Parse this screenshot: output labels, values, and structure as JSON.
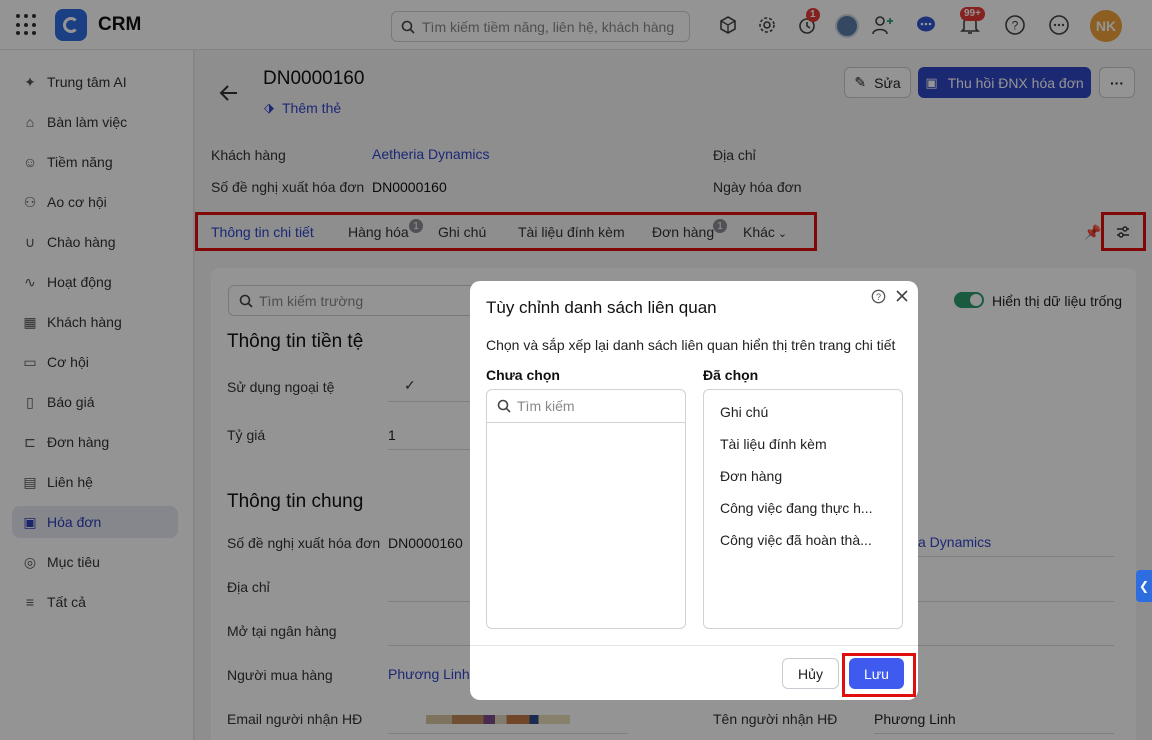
{
  "app": {
    "name": "CRM",
    "search_placeholder": "Tìm kiếm tiềm năng, liên hệ, khách hàng",
    "notif_timer_count": "1",
    "notif_bell_count": "99+",
    "avatar_initials": "NK"
  },
  "sidebar": {
    "items": [
      {
        "label": "Trung tâm AI",
        "icon": "sparkle-icon"
      },
      {
        "label": "Bàn làm việc",
        "icon": "home-icon"
      },
      {
        "label": "Tiềm năng",
        "icon": "lead-icon"
      },
      {
        "label": "Ao cơ hội",
        "icon": "opportunity-pool-icon"
      },
      {
        "label": "Chào hàng",
        "icon": "magnet-icon"
      },
      {
        "label": "Hoạt động",
        "icon": "activity-icon"
      },
      {
        "label": "Khách hàng",
        "icon": "building-icon"
      },
      {
        "label": "Cơ hội",
        "icon": "opportunity-icon"
      },
      {
        "label": "Báo giá",
        "icon": "quote-icon"
      },
      {
        "label": "Đơn hàng",
        "icon": "cart-icon"
      },
      {
        "label": "Liên hệ",
        "icon": "contact-icon"
      },
      {
        "label": "Hóa đơn",
        "icon": "invoice-icon"
      },
      {
        "label": "Mục tiêu",
        "icon": "target-icon"
      },
      {
        "label": "Tất cả",
        "icon": "menu-icon"
      }
    ]
  },
  "record": {
    "code": "DN0000160",
    "add_tag": "Thêm thẻ",
    "edit_label": "Sửa",
    "primary_action": "Thu hồi ĐNX hóa đơn",
    "more_label": "···"
  },
  "summary": {
    "customer_label": "Khách hàng",
    "customer_value": "Aetheria Dynamics",
    "address_label": "Địa chỉ",
    "request_no_label": "Số đề nghị xuất hóa đơn",
    "request_no_value": "DN0000160",
    "invoice_date_label": "Ngày hóa đơn"
  },
  "tabs": [
    {
      "label": "Thông tin chi tiết",
      "badge": ""
    },
    {
      "label": "Hàng hóa",
      "badge": "1"
    },
    {
      "label": "Ghi chú",
      "badge": ""
    },
    {
      "label": "Tài liệu đính kèm",
      "badge": ""
    },
    {
      "label": "Đơn hàng",
      "badge": "1"
    },
    {
      "label": "Khác",
      "badge": ""
    }
  ],
  "detail": {
    "field_search_placeholder": "Tìm kiếm trường",
    "show_empty_label": "Hiển thị dữ liệu trống",
    "section_currency": "Thông tin tiền tệ",
    "use_foreign_currency_label": "Sử dụng ngoại tệ",
    "use_foreign_currency_value": "✓",
    "exchange_rate_label": "Tỷ giá",
    "exchange_rate_value": "1",
    "section_general": "Thông tin chung",
    "request_no_label": "Số đề nghị xuất hóa đơn",
    "request_no_value": "DN0000160",
    "customer_partial": "a Dynamics",
    "address_label": "Địa chỉ",
    "bank_label": "Mở tại ngân hàng",
    "buyer_label": "Người mua hàng",
    "buyer_value": "Phương Linh",
    "email_label": "Email người nhận HĐ",
    "recipient_label": "Tên người nhận HĐ",
    "recipient_value": "Phương Linh"
  },
  "modal": {
    "title": "Tùy chỉnh danh sách liên quan",
    "description": "Chọn và sắp xếp lại danh sách liên quan hiển thị trên trang chi tiết",
    "unselected_title": "Chưa chọn",
    "search_placeholder": "Tìm kiếm",
    "selected_title": "Đã chọn",
    "selected_items": [
      "Ghi chú",
      "Tài liệu đính kèm",
      "Đơn hàng",
      "Công việc đang thực h...",
      "Công việc đã hoàn thà..."
    ],
    "cancel_label": "Hủy",
    "save_label": "Lưu"
  },
  "colors": {
    "primary": "#2f45c5",
    "active_nav_bg": "#e5e8f3",
    "highlight": "#e10e0e",
    "toggle": "#2e9e6e",
    "badge_red": "#e53935"
  }
}
